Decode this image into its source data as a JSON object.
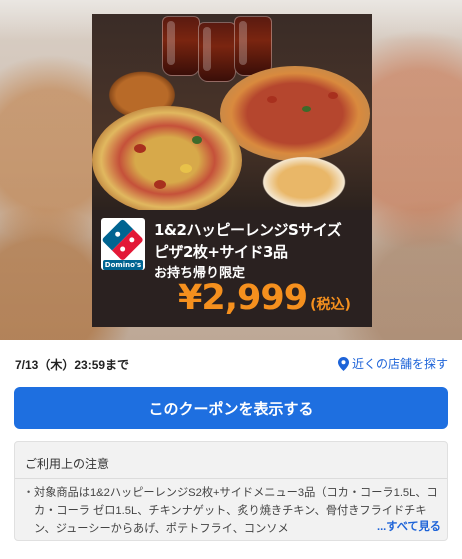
{
  "ad": {
    "brand": "Domino's",
    "line1": "1&2ハッピーレンジSサイズ",
    "line2": "ピザ2枚+サイド3品",
    "line3": "お持ち帰り限定",
    "price": "¥2,999",
    "tax": "(税込)",
    "accent_color": "#f5901e"
  },
  "expiry": {
    "text": "7/13（木）23:59まで"
  },
  "store_link": {
    "icon": "location-pin-icon",
    "label": "近くの店舗を探す"
  },
  "cta": {
    "label": "このクーポンを表示する",
    "color": "#1e6fe0"
  },
  "notice": {
    "title": "ご利用上の注意",
    "bullet": "・",
    "body": "対象商品は1&2ハッピーレンジS2枚+サイドメニュー3品（コカ・コーラ1.5L、コカ・コーラ ゼロ1.5L、チキンナゲット、炙り焼きチキン、骨付きフライドチキン、ジューシーからあげ、ポテトフライ、コンソメ",
    "see_more": "...すべて見る"
  }
}
